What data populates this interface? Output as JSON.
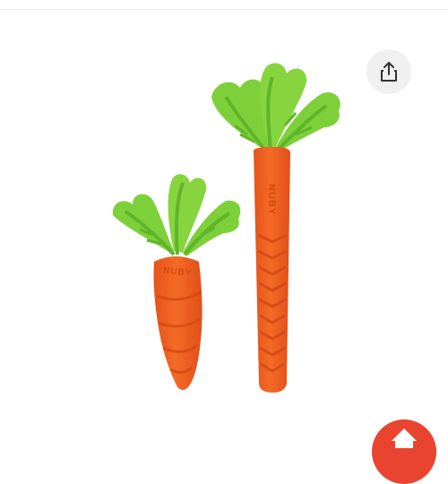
{
  "product": {
    "brand_mark": "NUBY",
    "colors": {
      "leaf": "#7ed03a",
      "leaf_dark": "#5fb52a",
      "carrot": "#f2601e",
      "carrot_dark": "#d94e12"
    }
  },
  "share": {
    "icon": "share-icon",
    "bg": "#f0f0f0"
  },
  "fab": {
    "icon": "home-icon",
    "color": "#e8442f"
  }
}
